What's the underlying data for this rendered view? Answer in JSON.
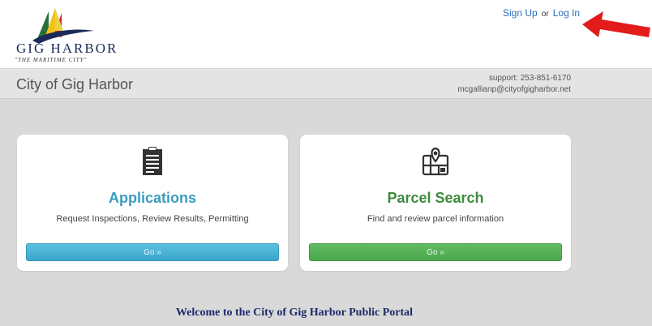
{
  "logo": {
    "name_text": "GIG HARBOR",
    "tagline": "\"THE MARITIME CITY\""
  },
  "auth": {
    "sign_up": "Sign Up",
    "or": "or",
    "log_in": "Log In"
  },
  "header": {
    "title": "City of Gig Harbor",
    "support_phone": "support: 253-851-6170",
    "support_email": "mcgallianp@cityofgigharbor.net"
  },
  "cards": [
    {
      "icon": "clipboard-icon",
      "title": "Applications",
      "description": "Request Inspections, Review Results, Permitting",
      "button": "Go »"
    },
    {
      "icon": "map-location-icon",
      "title": "Parcel Search",
      "description": "Find and review parcel information",
      "button": "Go »"
    }
  ],
  "welcome": "Welcome to the City of Gig Harbor Public Portal",
  "colors": {
    "link": "#2a6ebd",
    "applications_accent": "#3a9cbf",
    "parcel_accent": "#3d8b3d",
    "arrow": "#e41b1b",
    "welcome": "#1c2a6a"
  }
}
